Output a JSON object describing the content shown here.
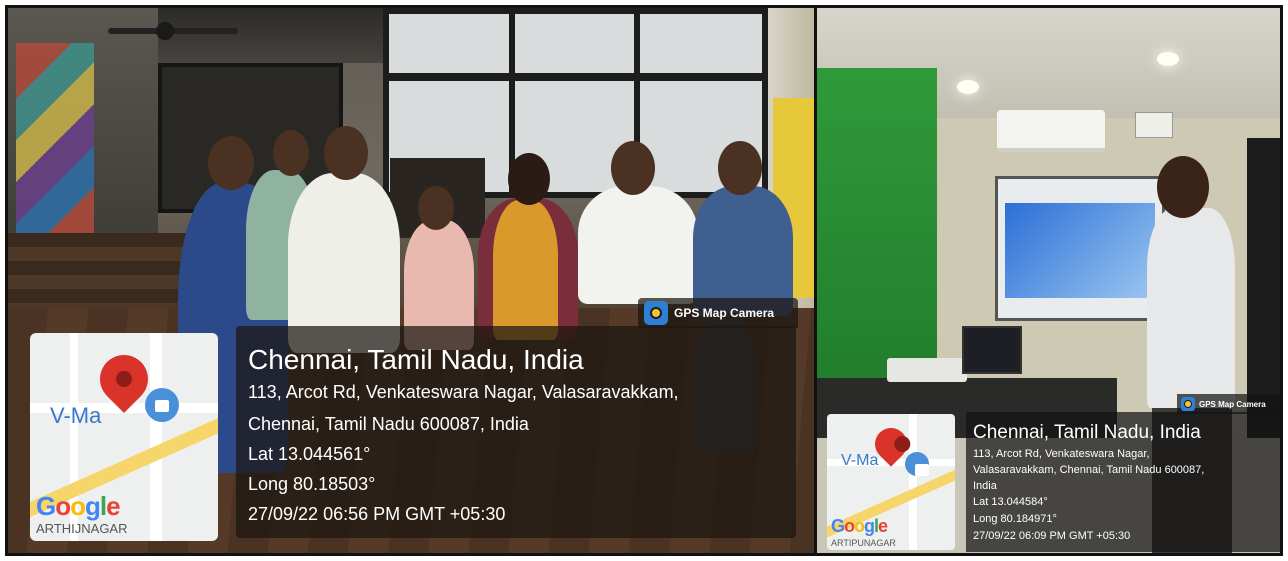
{
  "left_photo": {
    "badge": {
      "icon": "gps-map-camera-icon",
      "label": "GPS Map Camera"
    },
    "map": {
      "place_label": "V-Ma",
      "logo": "Google",
      "area_label": "ARTHIJNAGAR"
    },
    "location": {
      "title": "Chennai, Tamil Nadu, India",
      "address_line1": "113, Arcot Rd, Venkateswara Nagar, Valasaravakkam,",
      "address_line2": "Chennai, Tamil Nadu 600087, India",
      "lat": "Lat 13.044561°",
      "long": "Long 80.18503°",
      "timestamp": "27/09/22 06:56 PM GMT +05:30"
    }
  },
  "right_photo": {
    "badge": {
      "icon": "gps-map-camera-icon",
      "label": "GPS Map Camera"
    },
    "map": {
      "place_label": "V-Ma",
      "logo": "Google",
      "area_label": "ARTIPUNAGAR"
    },
    "location": {
      "title": "Chennai, Tamil Nadu, India",
      "address_line1": "113, Arcot Rd, Venkateswara Nagar,",
      "address_line2": "Valasaravakkam, Chennai, Tamil Nadu 600087,",
      "address_line3": "India",
      "lat": "Lat 13.044584°",
      "long": "Long 80.184971°",
      "timestamp": "27/09/22 06:09 PM GMT +05:30"
    }
  },
  "colors": {
    "overlay": "#1c1612",
    "pin": "#d9332a",
    "bag": "#4a90d9",
    "main_road": "#f6d66a",
    "green_wall": "#2f9a3a"
  }
}
